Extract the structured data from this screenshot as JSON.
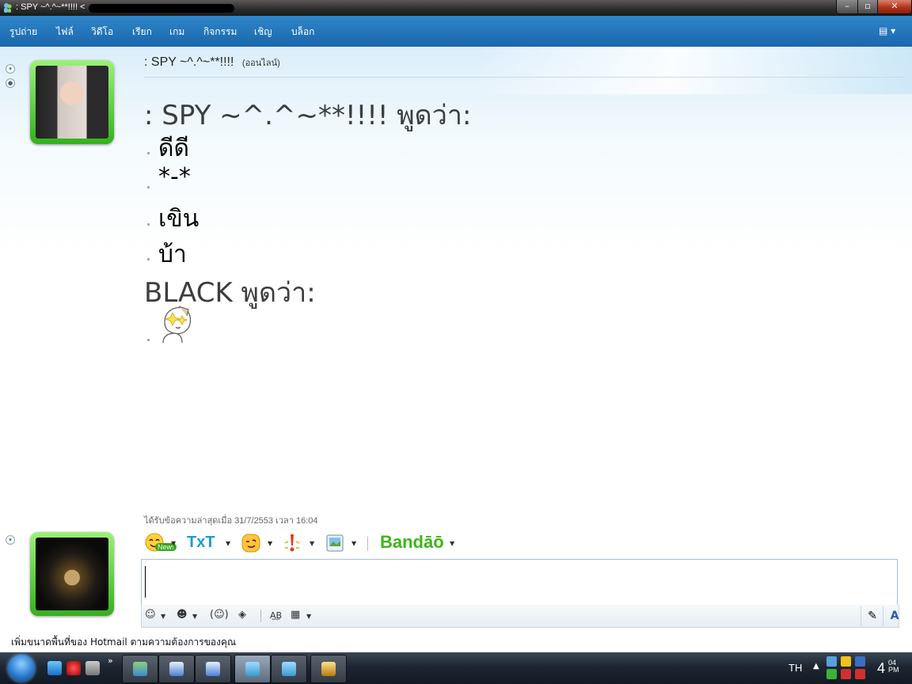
{
  "window": {
    "title": ": SPY ~^.^~**!!!! <"
  },
  "menu": {
    "items": [
      "รูปถ่าย",
      "ไฟล์",
      "วิดีโอ",
      "เรียก",
      "เกม",
      "กิจกรรม",
      "เชิญ",
      "บล็อก"
    ]
  },
  "contact": {
    "name": ": SPY ~^.^~**!!!!",
    "status": "(ออนไลน์)"
  },
  "conversation": {
    "speaker1": ": SPY ~^.^~**!!!! พูดว่า:",
    "messages1": [
      "ดีดี",
      "*-*",
      "เขิน",
      "บ้า"
    ],
    "speaker2": "BLACK พูดว่า:"
  },
  "last_message": "ได้รับข้อความล่าสุดเมื่อ 31/7/2553 เวลา 16:04",
  "toolbar": {
    "new_badge": "New!",
    "txt_label": "TxT",
    "bandoo_label": "Bandāō"
  },
  "format_bar": {
    "font_icon": "A"
  },
  "ad_text": "เพิ่มขนาดพื้นที่ของ Hotmail ตามความต้องการของคุณ",
  "taskbar": {
    "language": "TH",
    "clock_hour": "4",
    "clock_minute": "04",
    "clock_ampm": "PM"
  },
  "colors": {
    "menubar": "#2374bb",
    "avatar_frame": "#5ed23c",
    "bandoo_green": "#3fb51c"
  }
}
